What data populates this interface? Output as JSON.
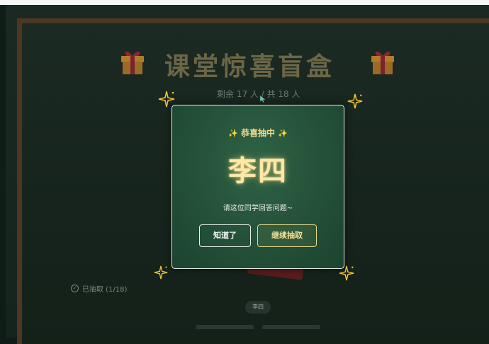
{
  "title": "课堂惊喜盲盒",
  "remaining": "剩余 17 人 / 共 18 人",
  "modal": {
    "heading": "恭喜抽中",
    "name": "李四",
    "subtitle": "请这位同学回答问题~",
    "ok_button": "知道了",
    "continue_button": "继续抽取"
  },
  "drawn_status": "已抽取 (1/18)",
  "drawn_list": [
    "李四"
  ],
  "colors": {
    "board": "#15241d",
    "modal": "#245038",
    "accent_gold": "#f0d990",
    "title": "#6b6646"
  }
}
